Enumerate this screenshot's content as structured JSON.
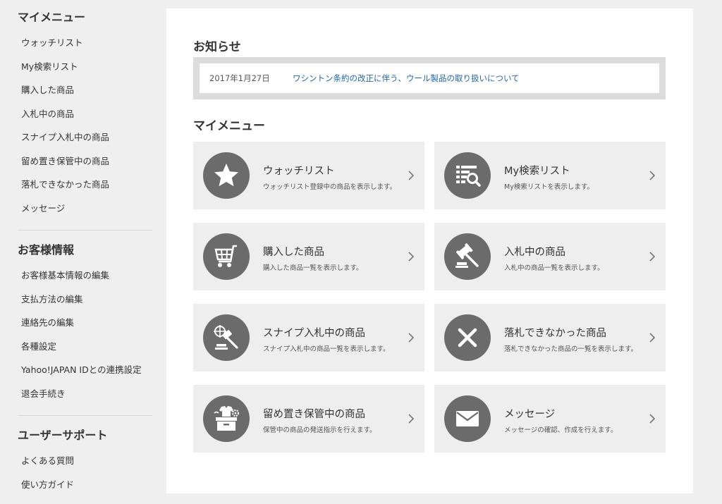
{
  "sidebar": {
    "sections": [
      {
        "title": "マイメニュー",
        "items": [
          "ウォッチリスト",
          "My検索リスト",
          "購入した商品",
          "入札中の商品",
          "スナイプ入札中の商品",
          "留め置き保管中の商品",
          "落札できなかった商品",
          "メッセージ"
        ]
      },
      {
        "title": "お客様情報",
        "items": [
          "お客様基本情報の編集",
          "支払方法の編集",
          "連絡先の編集",
          "各種設定",
          "Yahoo!JAPAN IDとの連携設定",
          "退会手続き"
        ]
      },
      {
        "title": "ユーザーサポート",
        "items": [
          "よくある質問",
          "使い方ガイド"
        ]
      }
    ]
  },
  "main": {
    "notice": {
      "title": "お知らせ",
      "date": "2017年1月27日",
      "link_text": "ワシントン条約の改正に伴う、ウール製品の取り扱いについて"
    },
    "menu_title": "マイメニュー",
    "cards": [
      {
        "icon": "star-icon",
        "title": "ウォッチリスト",
        "desc": "ウォッチリスト登録中の商品を表示します。"
      },
      {
        "icon": "search-list-icon",
        "title": "My検索リスト",
        "desc": "My検索リストを表示します。"
      },
      {
        "icon": "cart-icon",
        "title": "購入した商品",
        "desc": "購入した商品一覧を表示します。"
      },
      {
        "icon": "gavel-icon",
        "title": "入札中の商品",
        "desc": "入札中の商品一覧を表示します。"
      },
      {
        "icon": "snipe-gavel-icon",
        "title": "スナイプ入札中の商品",
        "desc": "スナイプ入札中の商品一覧を表示します。"
      },
      {
        "icon": "close-icon",
        "title": "落札できなかった商品",
        "desc": "落札できなかった商品の一覧を表示します。"
      },
      {
        "icon": "storage-box-icon",
        "title": "留め置き保管中の商品",
        "desc": "保管中の商品の発送指示を行えます。"
      },
      {
        "icon": "envelope-icon",
        "title": "メッセージ",
        "desc": "メッセージの確認、作成を行えます。"
      }
    ]
  },
  "colors": {
    "background": "#efefef",
    "panel": "#ffffff",
    "card": "#eeeeee",
    "icon_circle": "#6b6b6b",
    "link": "#2266aa"
  }
}
